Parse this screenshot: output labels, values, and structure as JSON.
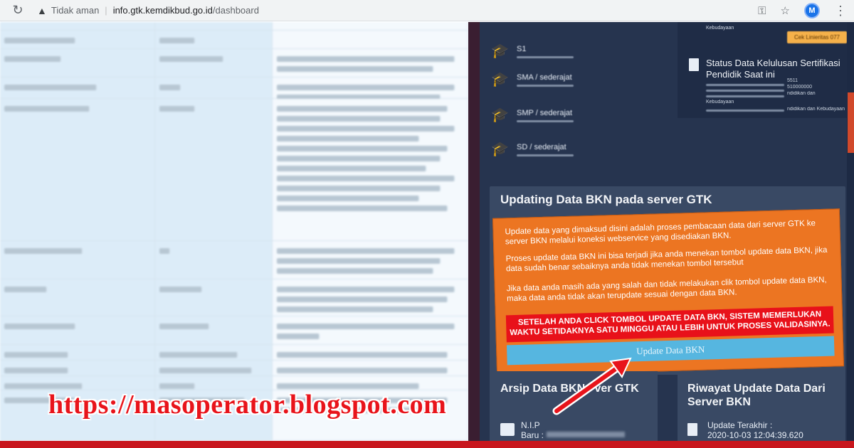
{
  "browser": {
    "security_label": "Tidak aman",
    "url_host": "info.gtk.kemdikbud.go.id",
    "url_path": "/dashboard",
    "reload_icon": "reload-icon",
    "warning_icon": "warning-triangle-icon",
    "key_icon": "key-icon",
    "star_icon": "star-icon",
    "avatar_icon": "profile-avatar-icon",
    "menu_icon": "kebab-menu-icon"
  },
  "education": [
    {
      "title": "S1",
      "icon": "graduation-cap-icon"
    },
    {
      "title": "SMA / sederajat",
      "icon": "graduation-cap-icon"
    },
    {
      "title": "SMP / sederajat",
      "icon": "graduation-cap-icon"
    },
    {
      "title": "SD / sederajat",
      "icon": "graduation-cap-icon"
    }
  ],
  "right_card": {
    "kebudayaan": "Kebudayaan",
    "cek_button": "Cek Linieritas 077",
    "sertifikasi_title": "Status Data Kelulusan Sertifikasi Pendidik Saat ini",
    "nrg_fragment": "5511",
    "amount_fragment": "510000000",
    "line_fragment_1": "ndidikan dan",
    "line_fragment_2": "Kebudayaan",
    "line_fragment_3": "ndidikan dan Kebudayaan"
  },
  "bkn": {
    "title": "Updating Data BKN pada server GTK",
    "para1": "Update data yang dimaksud disini adalah proses pembacaan data dari server GTK ke server BKN melalui koneksi webservice yang disediakan BKN.",
    "para2": "Proses update data BKN ini bisa terjadi jika anda menekan tombol update data BKN, jika data sudah benar sebaiknya anda tidak menekan tombol tersebut",
    "para3": "Jika data anda masih ada yang salah dan tidak melakukan clik tombol update data BKN, maka data anda tidak akan terupdate sesuai dengan data BKN.",
    "warning": "SETELAH ANDA CLICK TOMBOL UPDATE DATA BKN, SISTEM MEMERLUKAN WAKTU SETIDAKNYA SATU MINGGU ATAU LEBIH UNTUK PROSES VALIDASINYA.",
    "button": "Update Data BKN"
  },
  "arsip": {
    "title": "Arsip Data BKN",
    "title_tail": "ver GTK",
    "nip_label": "N.I.P",
    "baru_label": "Baru :"
  },
  "riwayat": {
    "title": "Riwayat Update Data Dari Server BKN",
    "update_label": "Update Terakhir :",
    "update_value": "2020-10-03 12:04:39.620"
  },
  "watermark": "https://masoperator.blogspot.com",
  "colors": {
    "panel_dark": "#26344f",
    "orange": "#ec7522",
    "warning_red": "#e8111a",
    "button_blue": "#56b6e0",
    "watermark_red": "#e8141b"
  }
}
